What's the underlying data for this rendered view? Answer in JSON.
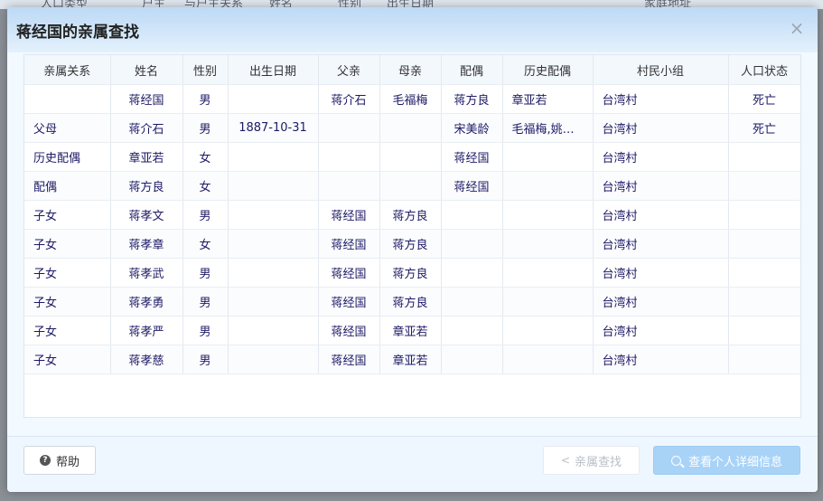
{
  "background_header": [
    "人口类型",
    "户主",
    "与户主关系",
    "姓名",
    "性别",
    "出生日期",
    "家庭地址"
  ],
  "modal": {
    "title": "蒋经国的亲属查找"
  },
  "table": {
    "columns": [
      "亲属关系",
      "姓名",
      "性别",
      "出生日期",
      "父亲",
      "母亲",
      "配偶",
      "历史配偶",
      "村民小组",
      "人口状态"
    ],
    "rows": [
      [
        "",
        "蒋经国",
        "男",
        "",
        "蒋介石",
        "毛福梅",
        "蒋方良",
        "章亚若",
        "台湾村",
        "死亡"
      ],
      [
        "父母",
        "蒋介石",
        "男",
        "1887-10-31",
        "",
        "",
        "宋美龄",
        "毛福梅,姚冶…",
        "台湾村",
        "死亡"
      ],
      [
        "历史配偶",
        "章亚若",
        "女",
        "",
        "",
        "",
        "蒋经国",
        "",
        "台湾村",
        ""
      ],
      [
        "配偶",
        "蒋方良",
        "女",
        "",
        "",
        "",
        "蒋经国",
        "",
        "台湾村",
        ""
      ],
      [
        "子女",
        "蒋孝文",
        "男",
        "",
        "蒋经国",
        "蒋方良",
        "",
        "",
        "台湾村",
        ""
      ],
      [
        "子女",
        "蒋孝章",
        "女",
        "",
        "蒋经国",
        "蒋方良",
        "",
        "",
        "台湾村",
        ""
      ],
      [
        "子女",
        "蒋孝武",
        "男",
        "",
        "蒋经国",
        "蒋方良",
        "",
        "",
        "台湾村",
        ""
      ],
      [
        "子女",
        "蒋孝勇",
        "男",
        "",
        "蒋经国",
        "蒋方良",
        "",
        "",
        "台湾村",
        ""
      ],
      [
        "子女",
        "蒋孝严",
        "男",
        "",
        "蒋经国",
        "章亚若",
        "",
        "",
        "台湾村",
        ""
      ],
      [
        "子女",
        "蒋孝慈",
        "男",
        "",
        "蒋经国",
        "章亚若",
        "",
        "",
        "台湾村",
        ""
      ]
    ]
  },
  "footer": {
    "help_label": "帮助",
    "relative_search_label": "亲属查找",
    "view_detail_label": "查看个人详细信息"
  },
  "icons": {
    "close": "close-icon",
    "help": "help-icon",
    "share": "share-icon",
    "search": "search-icon"
  },
  "colors": {
    "header_top": "#bcd9f5",
    "primary_disabled": "#a8d3f7",
    "cell_text": "#1e1a66"
  }
}
